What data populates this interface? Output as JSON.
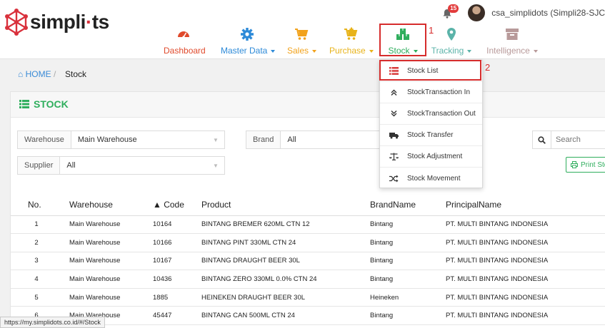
{
  "brand": {
    "name_prefix": "simpli",
    "name_dot": "·",
    "name_suffix": "ts"
  },
  "user": {
    "notifications": "15",
    "name": "csa_simplidots (Simpli28-SJC"
  },
  "menu": {
    "items": [
      {
        "label": "Dashboard",
        "color": "#e04a2c"
      },
      {
        "label": "Master Data",
        "color": "#2d8ad8"
      },
      {
        "label": "Sales",
        "color": "#f2a21b"
      },
      {
        "label": "Purchase",
        "color": "#e8b31a"
      },
      {
        "label": "Stock",
        "color": "#2fae5d"
      },
      {
        "label": "Tracking",
        "color": "#5bb3a9"
      },
      {
        "label": "Intelligence",
        "color": "#b89a9a"
      }
    ]
  },
  "annotations": {
    "num1": "1",
    "num2": "2"
  },
  "breadcrumb": {
    "home": "HOME",
    "separator": "/",
    "current": "Stock"
  },
  "page": {
    "title": "STOCK"
  },
  "filters": {
    "warehouse_label": "Warehouse",
    "warehouse_value": "Main Warehouse",
    "brand_label": "Brand",
    "brand_value": "All",
    "supplier_label": "Supplier",
    "supplier_value": "All",
    "search_placeholder": "Search",
    "print_label": "Print Sto"
  },
  "stock_menu": [
    {
      "label": "Stock List"
    },
    {
      "label": "StockTransaction In"
    },
    {
      "label": "StockTransaction Out"
    },
    {
      "label": "Stock Transfer"
    },
    {
      "label": "Stock Adjustment"
    },
    {
      "label": "Stock Movement"
    }
  ],
  "table": {
    "headers": {
      "no": "No.",
      "warehouse": "Warehouse",
      "code": "▲ Code",
      "product": "Product",
      "brand": "BrandName",
      "principal": "PrincipalName"
    },
    "rows": [
      {
        "no": "1",
        "warehouse": "Main Warehouse",
        "code": "10164",
        "product": "BINTANG BREMER 620ML CTN 12",
        "brand": "Bintang",
        "principal": "PT. MULTI BINTANG INDONESIA"
      },
      {
        "no": "2",
        "warehouse": "Main Warehouse",
        "code": "10166",
        "product": "BINTANG PINT 330ML CTN 24",
        "brand": "Bintang",
        "principal": "PT. MULTI BINTANG INDONESIA"
      },
      {
        "no": "3",
        "warehouse": "Main Warehouse",
        "code": "10167",
        "product": "BINTANG DRAUGHT BEER 30L",
        "brand": "Bintang",
        "principal": "PT. MULTI BINTANG INDONESIA"
      },
      {
        "no": "4",
        "warehouse": "Main Warehouse",
        "code": "10436",
        "product": "BINTANG ZERO 330ML 0.0% CTN 24",
        "brand": "Bintang",
        "principal": "PT. MULTI BINTANG INDONESIA"
      },
      {
        "no": "5",
        "warehouse": "Main Warehouse",
        "code": "1885",
        "product": "HEINEKEN DRAUGHT BEER 30L",
        "brand": "Heineken",
        "principal": "PT. MULTI BINTANG INDONESIA"
      },
      {
        "no": "6",
        "warehouse": "Main Warehouse",
        "code": "45447",
        "product": "BINTANG CAN 500ML CTN 24",
        "brand": "Bintang",
        "principal": "PT. MULTI BINTANG INDONESIA"
      }
    ]
  },
  "status_url": "https://my.simplidots.co.id/#/Stock"
}
